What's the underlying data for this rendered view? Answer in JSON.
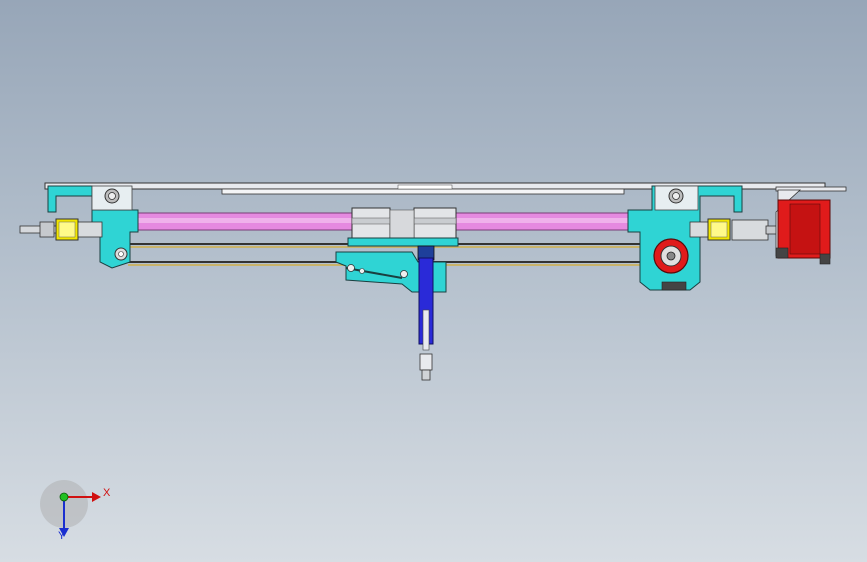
{
  "colors": {
    "background_top": "#97a6b8",
    "background_bottom": "#d7dde3",
    "bracket": "#2fd4d4",
    "rail": "#e58ae0",
    "motor": "#e01b1b",
    "shaft": "#2a2ad8",
    "coupler": "#f2e600",
    "plate": "#e8eaee",
    "belt": "#c9b36a"
  },
  "icons": {
    "triad": "axis-triad-icon",
    "motor": "stepper-motor-icon"
  },
  "triad": {
    "x_label": "X",
    "y_label": "Y"
  }
}
